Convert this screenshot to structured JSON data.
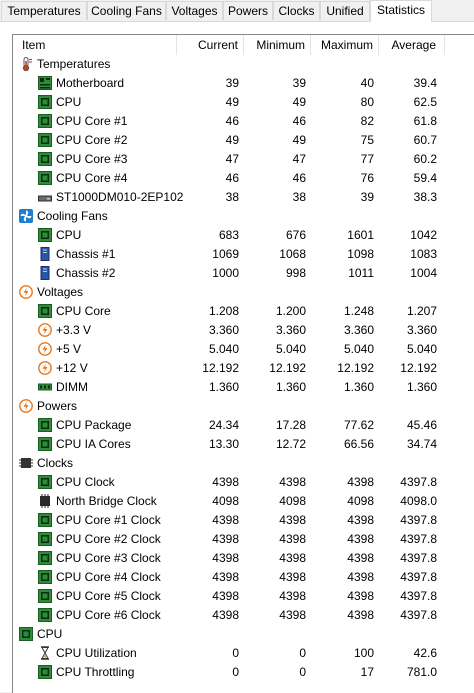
{
  "tabs": [
    {
      "label": "Temperatures",
      "active": false
    },
    {
      "label": "Cooling Fans",
      "active": false
    },
    {
      "label": "Voltages",
      "active": false
    },
    {
      "label": "Powers",
      "active": false
    },
    {
      "label": "Clocks",
      "active": false
    },
    {
      "label": "Unified",
      "active": false
    },
    {
      "label": "Statistics",
      "active": true
    }
  ],
  "columns": {
    "item": "Item",
    "current": "Current",
    "minimum": "Minimum",
    "maximum": "Maximum",
    "average": "Average"
  },
  "rows": [
    {
      "kind": "group",
      "icon": "thermometer-icon",
      "label": "Temperatures"
    },
    {
      "kind": "item",
      "icon": "motherboard-icon",
      "label": "Motherboard",
      "current": "39",
      "minimum": "39",
      "maximum": "40",
      "average": "39.4"
    },
    {
      "kind": "item",
      "icon": "chip-icon",
      "label": "CPU",
      "current": "49",
      "minimum": "49",
      "maximum": "80",
      "average": "62.5"
    },
    {
      "kind": "item",
      "icon": "chip-icon",
      "label": "CPU Core #1",
      "current": "46",
      "minimum": "46",
      "maximum": "82",
      "average": "61.8"
    },
    {
      "kind": "item",
      "icon": "chip-icon",
      "label": "CPU Core #2",
      "current": "49",
      "minimum": "49",
      "maximum": "75",
      "average": "60.7"
    },
    {
      "kind": "item",
      "icon": "chip-icon",
      "label": "CPU Core #3",
      "current": "47",
      "minimum": "47",
      "maximum": "77",
      "average": "60.2"
    },
    {
      "kind": "item",
      "icon": "chip-icon",
      "label": "CPU Core #4",
      "current": "46",
      "minimum": "46",
      "maximum": "76",
      "average": "59.4"
    },
    {
      "kind": "item",
      "icon": "hard-drive-icon",
      "label": "ST1000DM010-2EP102",
      "current": "38",
      "minimum": "38",
      "maximum": "39",
      "average": "38.3"
    },
    {
      "kind": "group",
      "icon": "fan-icon",
      "label": "Cooling Fans"
    },
    {
      "kind": "item",
      "icon": "chip-icon",
      "label": "CPU",
      "current": "683",
      "minimum": "676",
      "maximum": "1601",
      "average": "1042"
    },
    {
      "kind": "item",
      "icon": "chassis-icon",
      "label": "Chassis #1",
      "current": "1069",
      "minimum": "1068",
      "maximum": "1098",
      "average": "1083"
    },
    {
      "kind": "item",
      "icon": "chassis-icon",
      "label": "Chassis #2",
      "current": "1000",
      "minimum": "998",
      "maximum": "1011",
      "average": "1004"
    },
    {
      "kind": "group",
      "icon": "lightning-icon",
      "label": "Voltages"
    },
    {
      "kind": "item",
      "icon": "chip-icon",
      "label": "CPU Core",
      "current": "1.208",
      "minimum": "1.200",
      "maximum": "1.248",
      "average": "1.207"
    },
    {
      "kind": "item",
      "icon": "lightning-icon",
      "label": "+3.3 V",
      "current": "3.360",
      "minimum": "3.360",
      "maximum": "3.360",
      "average": "3.360"
    },
    {
      "kind": "item",
      "icon": "lightning-icon",
      "label": "+5 V",
      "current": "5.040",
      "minimum": "5.040",
      "maximum": "5.040",
      "average": "5.040"
    },
    {
      "kind": "item",
      "icon": "lightning-icon",
      "label": "+12 V",
      "current": "12.192",
      "minimum": "12.192",
      "maximum": "12.192",
      "average": "12.192"
    },
    {
      "kind": "item",
      "icon": "dimm-icon",
      "label": "DIMM",
      "current": "1.360",
      "minimum": "1.360",
      "maximum": "1.360",
      "average": "1.360"
    },
    {
      "kind": "group",
      "icon": "lightning-icon",
      "label": "Powers"
    },
    {
      "kind": "item",
      "icon": "chip-icon",
      "label": "CPU Package",
      "current": "24.34",
      "minimum": "17.28",
      "maximum": "77.62",
      "average": "45.46"
    },
    {
      "kind": "item",
      "icon": "chip-icon",
      "label": "CPU IA Cores",
      "current": "13.30",
      "minimum": "12.72",
      "maximum": "66.56",
      "average": "34.74"
    },
    {
      "kind": "group",
      "icon": "clock-chip-icon",
      "label": "Clocks"
    },
    {
      "kind": "item",
      "icon": "chip-icon",
      "label": "CPU Clock",
      "current": "4398",
      "minimum": "4398",
      "maximum": "4398",
      "average": "4397.8"
    },
    {
      "kind": "item",
      "icon": "northbridge-icon",
      "label": "North Bridge Clock",
      "current": "4098",
      "minimum": "4098",
      "maximum": "4098",
      "average": "4098.0"
    },
    {
      "kind": "item",
      "icon": "chip-icon",
      "label": "CPU Core #1 Clock",
      "current": "4398",
      "minimum": "4398",
      "maximum": "4398",
      "average": "4397.8"
    },
    {
      "kind": "item",
      "icon": "chip-icon",
      "label": "CPU Core #2 Clock",
      "current": "4398",
      "minimum": "4398",
      "maximum": "4398",
      "average": "4397.8"
    },
    {
      "kind": "item",
      "icon": "chip-icon",
      "label": "CPU Core #3 Clock",
      "current": "4398",
      "minimum": "4398",
      "maximum": "4398",
      "average": "4397.8"
    },
    {
      "kind": "item",
      "icon": "chip-icon",
      "label": "CPU Core #4 Clock",
      "current": "4398",
      "minimum": "4398",
      "maximum": "4398",
      "average": "4397.8"
    },
    {
      "kind": "item",
      "icon": "chip-icon",
      "label": "CPU Core #5 Clock",
      "current": "4398",
      "minimum": "4398",
      "maximum": "4398",
      "average": "4397.8"
    },
    {
      "kind": "item",
      "icon": "chip-icon",
      "label": "CPU Core #6 Clock",
      "current": "4398",
      "minimum": "4398",
      "maximum": "4398",
      "average": "4397.8"
    },
    {
      "kind": "group",
      "icon": "chip-icon",
      "label": "CPU"
    },
    {
      "kind": "item",
      "icon": "hourglass-icon",
      "label": "CPU Utilization",
      "current": "0",
      "minimum": "0",
      "maximum": "100",
      "average": "42.6"
    },
    {
      "kind": "item",
      "icon": "chip-icon",
      "label": "CPU Throttling",
      "current": "0",
      "minimum": "0",
      "maximum": "17",
      "average": "781.0"
    }
  ],
  "colors": {
    "chip": "#2e8b3a",
    "chip_dark": "#1a5e22",
    "lightning": "#e8771a",
    "fan": "#1e7fd0",
    "thermo": "#d23a1f",
    "chassis": "#2855a8"
  }
}
